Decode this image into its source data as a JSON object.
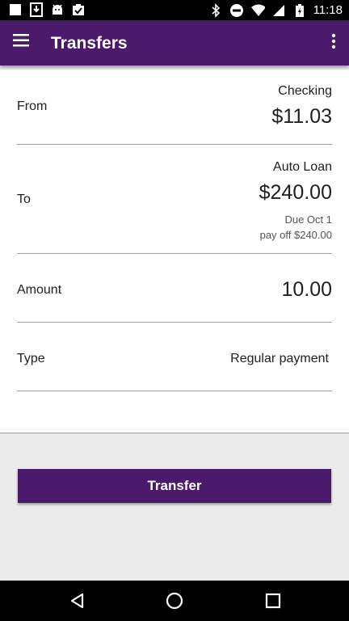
{
  "status_bar": {
    "time": "11:18",
    "left_icons": [
      "square-notification-icon",
      "download-icon",
      "android-icon",
      "clipboard-check-icon"
    ],
    "right_icons": [
      "bluetooth-icon",
      "do-not-disturb-icon",
      "wifi-icon",
      "signal-icon",
      "battery-charging-icon"
    ]
  },
  "app_bar": {
    "title": "Transfers",
    "menu_icon": "hamburger-menu-icon",
    "more_icon": "more-vertical-icon",
    "color": "#4b1a6b"
  },
  "form": {
    "from": {
      "label": "From",
      "account_name": "Checking",
      "balance": "$11.03"
    },
    "to": {
      "label": "To",
      "account_name": "Auto Loan",
      "balance": "$240.00",
      "due": "Due Oct 1",
      "payoff": "pay off $240.00"
    },
    "amount": {
      "label": "Amount",
      "value": "10.00"
    },
    "type": {
      "label": "Type",
      "value": "Regular payment"
    }
  },
  "actions": {
    "transfer_label": "Transfer"
  },
  "nav_bar": {
    "icons": [
      "back-triangle-icon",
      "home-circle-icon",
      "recents-square-icon"
    ]
  }
}
